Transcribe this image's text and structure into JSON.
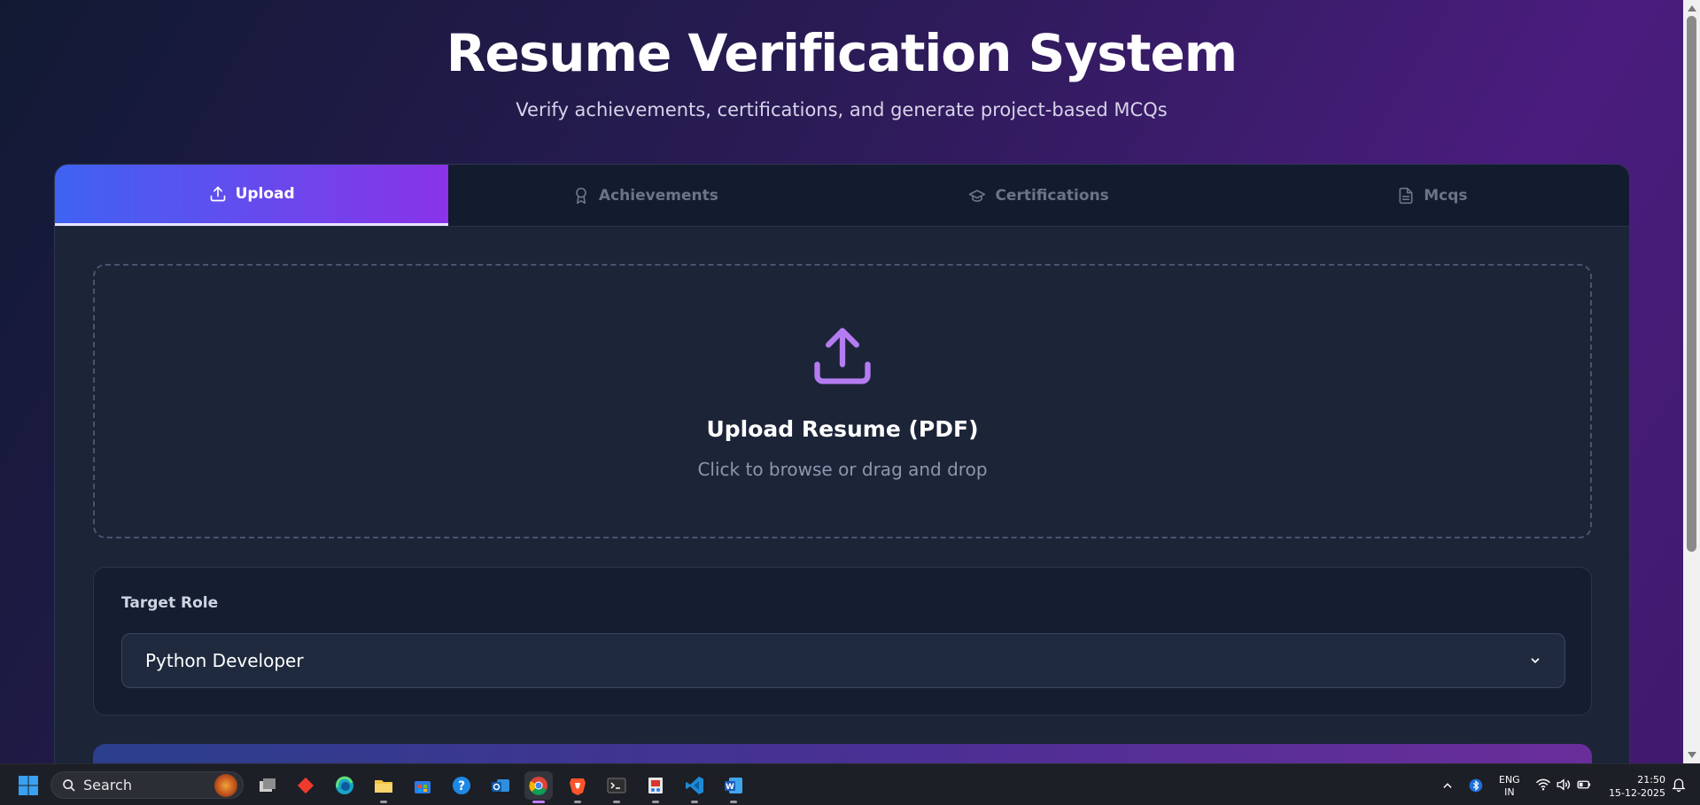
{
  "page": {
    "title": "Resume Verification System",
    "subtitle": "Verify achievements, certifications, and generate project-based MCQs"
  },
  "tabs": [
    {
      "label": "Upload",
      "icon": "upload-icon",
      "active": true
    },
    {
      "label": "Achievements",
      "icon": "award-icon",
      "active": false
    },
    {
      "label": "Certifications",
      "icon": "graduation-cap-icon",
      "active": false
    },
    {
      "label": "Mcqs",
      "icon": "file-text-icon",
      "active": false
    }
  ],
  "dropzone": {
    "icon": "upload-icon",
    "title": "Upload Resume (PDF)",
    "hint": "Click to browse or drag and drop"
  },
  "role": {
    "label": "Target Role",
    "selected": "Python Developer"
  },
  "colors": {
    "accent_start": "#3f63f2",
    "accent_end": "#8a33e8",
    "upload_icon": "#b57cf2",
    "card_bg": "#1c2438"
  },
  "taskbar": {
    "search_placeholder": "Search",
    "apps": [
      "task-view-icon",
      "anydesk-icon",
      "edge-icon",
      "file-explorer-icon",
      "microsoft-store-icon",
      "help-icon",
      "outlook-icon",
      "chrome-icon",
      "brave-icon",
      "terminal-icon",
      "snipping-tool-icon",
      "vscode-icon",
      "word-icon"
    ],
    "language": {
      "line1": "ENG",
      "line2": "IN"
    },
    "time": "21:50",
    "date": "15-12-2025"
  }
}
